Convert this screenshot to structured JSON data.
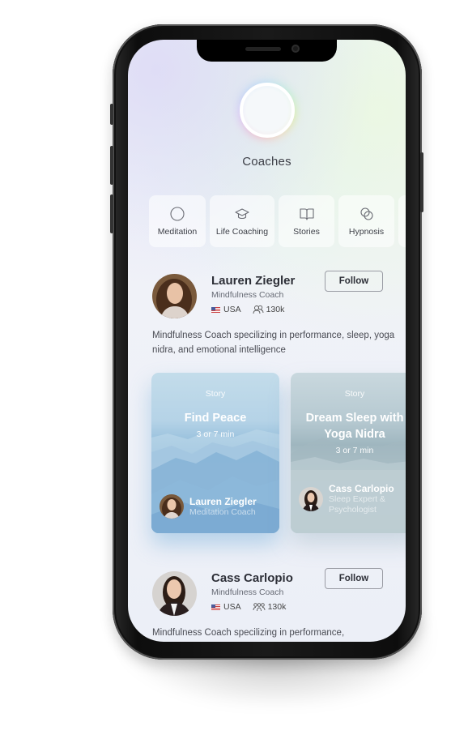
{
  "header": {
    "title": "Coaches"
  },
  "categories": [
    {
      "label": "Meditation",
      "icon": "circle-icon"
    },
    {
      "label": "Life Coaching",
      "icon": "graduation-cap-icon"
    },
    {
      "label": "Stories",
      "icon": "book-icon"
    },
    {
      "label": "Hypnosis",
      "icon": "overlapping-circles-icon"
    }
  ],
  "coaches": [
    {
      "name": "Lauren Ziegler",
      "role": "Mindfulness Coach",
      "country": "USA",
      "followers": "130k",
      "follow_label": "Follow",
      "bio": "Mindfulness Coach specilizing in performance, sleep, yoga nidra, and emotional intelligence"
    },
    {
      "name": "Cass Carlopio",
      "role": "Mindfulness Coach",
      "country": "USA",
      "followers": "130k",
      "follow_label": "Follow",
      "bio": "Mindfulness Coach specilizing in performance,"
    }
  ],
  "stories": [
    {
      "label": "Story",
      "title": "Find Peace",
      "duration": "3 or 7 min",
      "author_name": "Lauren Ziegler",
      "author_role": "Meditation Coach"
    },
    {
      "label": "Story",
      "title_line1": "Dream Sleep with",
      "title_line2": "Yoga Nidra",
      "duration": "3 or 7 min",
      "author_name": "Cass Carlopio",
      "author_role_line1": "Sleep Expert &",
      "author_role_line2": "Psychologist"
    }
  ]
}
